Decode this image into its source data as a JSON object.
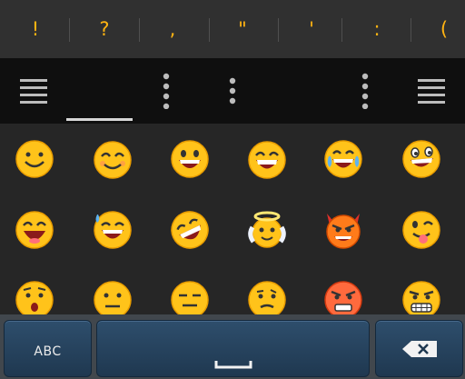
{
  "symbols": [
    "!",
    "?",
    ",",
    "\"",
    "'",
    ":",
    "("
  ],
  "categories": [
    "menu-icon",
    "recent-emoji-tab",
    "dots-icon",
    "dots-icon",
    "dots-icon",
    "menu-icon"
  ],
  "emoji": [
    [
      "smiling-face-icon",
      "smiling-eyes-face-icon",
      "grinning-face-icon",
      "grinning-squint-face-icon",
      "tears-of-joy-face-icon",
      "grinning-big-eyes-face-icon"
    ],
    [
      "laughing-face-icon",
      "sweat-smile-face-icon",
      "rolling-laughing-face-icon",
      "angel-face-icon",
      "devil-face-icon",
      "winking-tongue-face-icon"
    ],
    [
      "worried-face-icon",
      "neutral-face-icon",
      "expressionless-face-icon",
      "confused-face-icon",
      "angry-face-icon",
      "grimacing-face-icon"
    ]
  ],
  "keyboard": {
    "abc_label": "ABC"
  },
  "colors": {
    "accent": "#ffb312",
    "keyboard_bg": "#41474d",
    "key_blue": "#274563"
  }
}
